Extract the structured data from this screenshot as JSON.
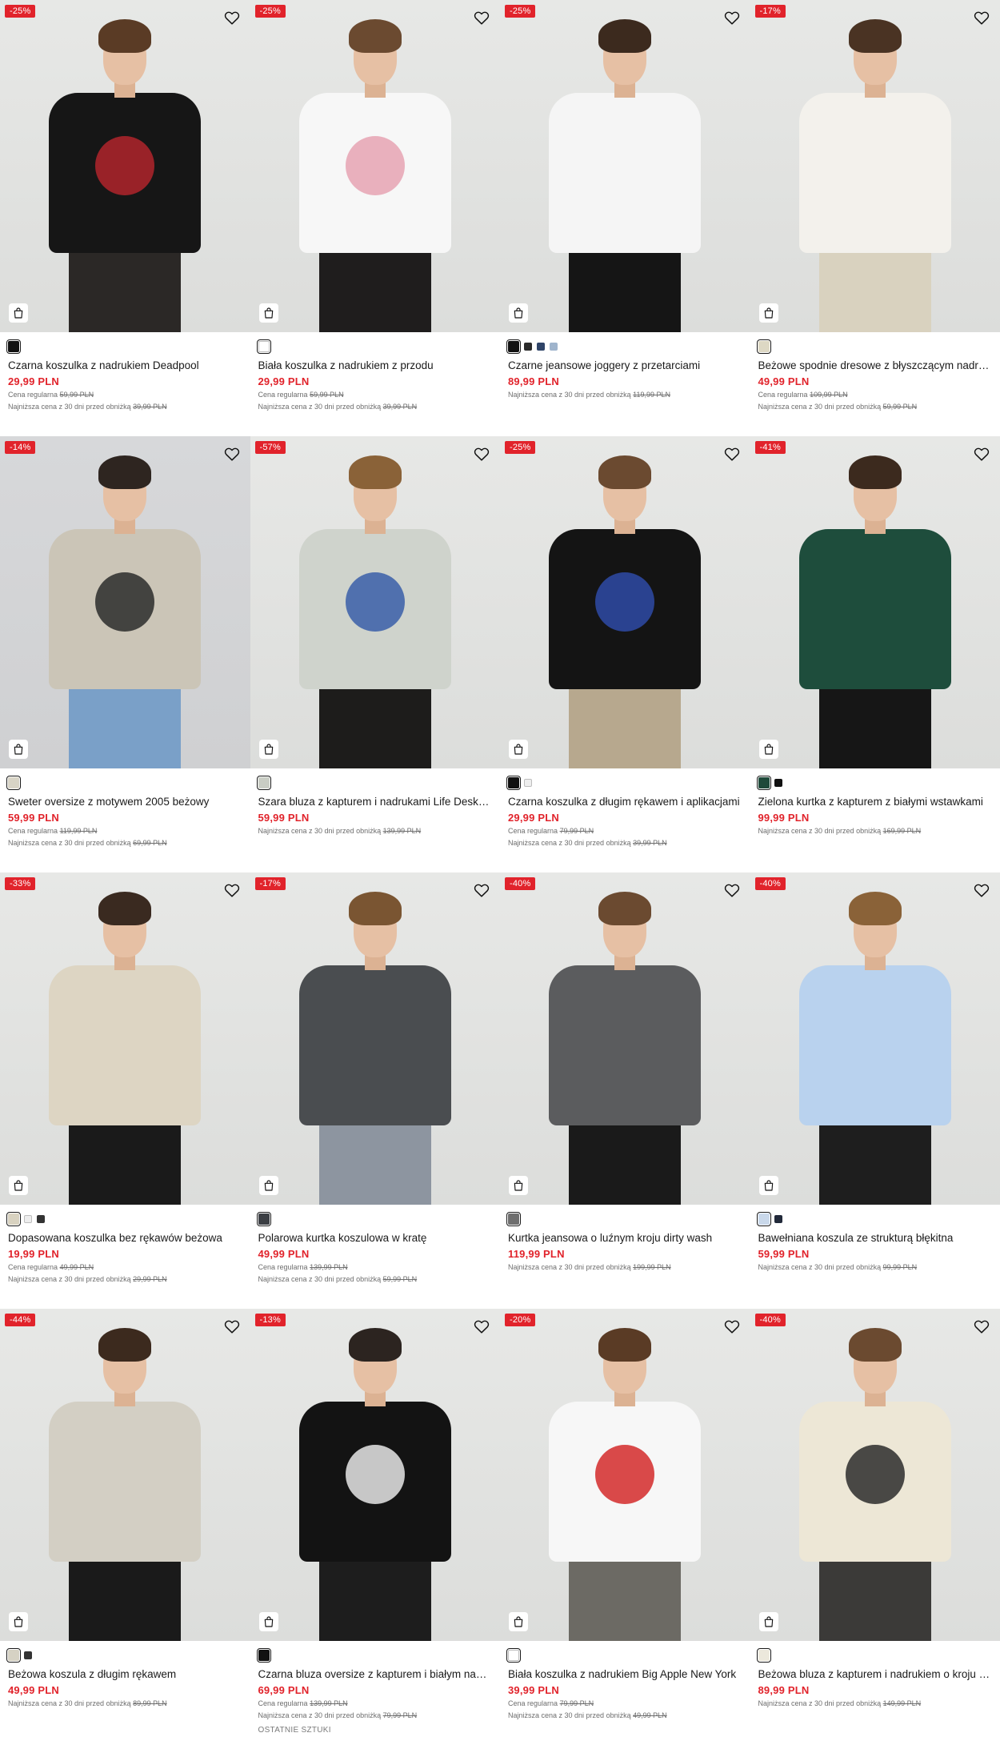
{
  "products": [
    {
      "badge": "-25%",
      "swatches": [
        "#111111"
      ],
      "name": "Czarna koszulka z nadrukiem Deadpool",
      "price": "29,99 PLN",
      "regular_label": "Cena regularna",
      "regular_price": "59,99 PLN",
      "lowest_label": "Najniższa cena z 30 dni przed obniżką",
      "lowest_price": "39,99 PLN",
      "extra": "",
      "look": {
        "top": "#161616",
        "legs": "#2b2826",
        "print": "#b0252c",
        "hair": "#5a3b25",
        "alt": false
      }
    },
    {
      "badge": "-25%",
      "swatches": [
        "#ffffff"
      ],
      "name": "Biała koszulka z nadrukiem z przodu",
      "price": "29,99 PLN",
      "regular_label": "Cena regularna",
      "regular_price": "59,99 PLN",
      "lowest_label": "Najniższa cena z 30 dni przed obniżką",
      "lowest_price": "39,99 PLN",
      "extra": "",
      "look": {
        "top": "#f7f7f7",
        "legs": "#1f1d1d",
        "print": "#e6a3b3",
        "hair": "#6b4a30",
        "alt": false
      }
    },
    {
      "badge": "-25%",
      "swatches": [
        "#111111",
        "#2a2a2a",
        "#2f4468",
        "#9fb4cc"
      ],
      "name": "Czarne jeansowe joggery z przetarciami",
      "price": "89,99 PLN",
      "regular_label": "",
      "regular_price": "",
      "lowest_label": "Najniższa cena z 30 dni przed obniżką",
      "lowest_price": "119,99 PLN",
      "extra": "",
      "look": {
        "top": "#f5f5f5",
        "legs": "#151515",
        "print": "",
        "hair": "#3c2a1e",
        "alt": false
      }
    },
    {
      "badge": "-17%",
      "swatches": [
        "#ddd8c4"
      ],
      "name": "Beżowe spodnie dresowe z błyszczącym nadrukiem",
      "price": "49,99 PLN",
      "regular_label": "Cena regularna",
      "regular_price": "109,99 PLN",
      "lowest_label": "Najniższa cena z 30 dni przed obniżką",
      "lowest_price": "59,99 PLN",
      "extra": "",
      "look": {
        "top": "#f3f1ec",
        "legs": "#d9d2bf",
        "print": "",
        "hair": "#4a3323",
        "alt": false
      }
    },
    {
      "badge": "-14%",
      "swatches": [
        "#d8d4c6"
      ],
      "name": "Sweter oversize z motywem 2005 beżowy",
      "price": "59,99 PLN",
      "regular_label": "Cena regularna",
      "regular_price": "119,99 PLN",
      "lowest_label": "Najniższa cena z 30 dni przed obniżką",
      "lowest_price": "69,99 PLN",
      "extra": "",
      "look": {
        "top": "#cbc5b7",
        "legs": "#7aa0c8",
        "print": "#2b2b2b",
        "hair": "#2e2520",
        "alt": true
      }
    },
    {
      "badge": "-57%",
      "swatches": [
        "#c9cdc4"
      ],
      "name": "Szara bluza z kapturem i nadrukami Life Desktop",
      "price": "59,99 PLN",
      "regular_label": "",
      "regular_price": "",
      "lowest_label": "Najniższa cena z 30 dni przed obniżką",
      "lowest_price": "139,99 PLN",
      "extra": "",
      "look": {
        "top": "#cfd3cc",
        "legs": "#1d1c1b",
        "print": "#3a5ea8",
        "hair": "#8a6238",
        "alt": false
      }
    },
    {
      "badge": "-25%",
      "swatches": [
        "#111111",
        "#eeeeee"
      ],
      "name": "Czarna koszulka z długim rękawem i aplikacjami",
      "price": "29,99 PLN",
      "regular_label": "Cena regularna",
      "regular_price": "79,99 PLN",
      "lowest_label": "Najniższa cena z 30 dni przed obniżką",
      "lowest_price": "39,99 PLN",
      "extra": "",
      "look": {
        "top": "#141414",
        "legs": "#b7a88e",
        "print": "#2e4aa6",
        "hair": "#6b4a30",
        "alt": false
      }
    },
    {
      "badge": "-41%",
      "swatches": [
        "#1f4a3a",
        "#111111"
      ],
      "name": "Zielona kurtka z kapturem z białymi wstawkami",
      "price": "99,99 PLN",
      "regular_label": "",
      "regular_price": "",
      "lowest_label": "Najniższa cena z 30 dni przed obniżką",
      "lowest_price": "169,99 PLN",
      "extra": "",
      "look": {
        "top": "#1e4d3c",
        "legs": "#161616",
        "print": "",
        "hair": "#3c2a1e",
        "alt": false
      }
    },
    {
      "badge": "-33%",
      "swatches": [
        "#d8d2c0",
        "#eeeeee",
        "#333333"
      ],
      "name": "Dopasowana koszulka bez rękawów beżowa",
      "price": "19,99 PLN",
      "regular_label": "Cena regularna",
      "regular_price": "49,99 PLN",
      "lowest_label": "Najniższa cena z 30 dni przed obniżką",
      "lowest_price": "29,99 PLN",
      "extra": "",
      "look": {
        "top": "#ddd5c3",
        "legs": "#1a1a1a",
        "print": "",
        "hair": "#3a2a20",
        "alt": false
      }
    },
    {
      "badge": "-17%",
      "swatches": [
        "#3c3f44"
      ],
      "name": "Polarowa kurtka koszulowa w kratę",
      "price": "49,99 PLN",
      "regular_label": "Cena regularna",
      "regular_price": "139,99 PLN",
      "lowest_label": "Najniższa cena z 30 dni przed obniżką",
      "lowest_price": "59,99 PLN",
      "extra": "",
      "look": {
        "top": "#4a4d50",
        "legs": "#8d95a0",
        "print": "",
        "hair": "#7a5532",
        "alt": false
      }
    },
    {
      "badge": "-40%",
      "swatches": [
        "#6f6f6f"
      ],
      "name": "Kurtka jeansowa o luźnym kroju dirty wash",
      "price": "119,99 PLN",
      "regular_label": "",
      "regular_price": "",
      "lowest_label": "Najniższa cena z 30 dni przed obniżką",
      "lowest_price": "199,99 PLN",
      "extra": "",
      "look": {
        "top": "#5b5c5e",
        "legs": "#1a1a1a",
        "print": "",
        "hair": "#6b4a30",
        "alt": false
      }
    },
    {
      "badge": "-40%",
      "swatches": [
        "#c9d8ea",
        "#222a3a"
      ],
      "name": "Bawełniana koszula ze strukturą błękitna",
      "price": "59,99 PLN",
      "regular_label": "",
      "regular_price": "",
      "lowest_label": "Najniższa cena z 30 dni przed obniżką",
      "lowest_price": "99,99 PLN",
      "extra": "",
      "look": {
        "top": "#b9d2ee",
        "legs": "#1e1e1e",
        "print": "",
        "hair": "#8a6238",
        "alt": false
      }
    },
    {
      "badge": "-44%",
      "swatches": [
        "#d6d2c4",
        "#333333"
      ],
      "name": "Beżowa koszula z długim rękawem",
      "price": "49,99 PLN",
      "regular_label": "",
      "regular_price": "",
      "lowest_label": "Najniższa cena z 30 dni przed obniżką",
      "lowest_price": "89,99 PLN",
      "extra": "",
      "look": {
        "top": "#d3cfc4",
        "legs": "#1a1a1a",
        "print": "",
        "hair": "#3c2a1e",
        "alt": false
      }
    },
    {
      "badge": "-13%",
      "swatches": [
        "#111111"
      ],
      "name": "Czarna bluza oversize z kapturem i białym nadrukiem",
      "price": "69,99 PLN",
      "regular_label": "Cena regularna",
      "regular_price": "139,99 PLN",
      "lowest_label": "Najniższa cena z 30 dni przed obniżką",
      "lowest_price": "79,99 PLN",
      "extra": "OSTATNIE SZTUKI",
      "look": {
        "top": "#131313",
        "legs": "#1d1d1d",
        "print": "#e8e8e8",
        "hair": "#2c2420",
        "alt": false
      }
    },
    {
      "badge": "-20%",
      "swatches": [
        "#ffffff"
      ],
      "name": "Biała koszulka z nadrukiem Big Apple New York",
      "price": "39,99 PLN",
      "regular_label": "Cena regularna",
      "regular_price": "79,99 PLN",
      "lowest_label": "Najniższa cena z 30 dni przed obniżką",
      "lowest_price": "49,99 PLN",
      "extra": "",
      "look": {
        "top": "#f7f7f7",
        "legs": "#6c6a64",
        "print": "#d42a2a",
        "hair": "#5a3b25",
        "alt": false
      }
    },
    {
      "badge": "-40%",
      "swatches": [
        "#ece8dc"
      ],
      "name": "Beżowa bluza z kapturem i nadrukiem o kroju oversize",
      "price": "89,99 PLN",
      "regular_label": "",
      "regular_price": "",
      "lowest_label": "Najniższa cena z 30 dni przed obniżką",
      "lowest_price": "149,99 PLN",
      "extra": "",
      "look": {
        "top": "#ede7d6",
        "legs": "#3b3a38",
        "print": "#2b2b2b",
        "hair": "#6b4a30",
        "alt": false
      }
    }
  ],
  "colors": {
    "accent": "#e1232b",
    "text": "#1a1a1a",
    "muted": "#6d6d6d"
  },
  "icons": {
    "wishlist": "heart-icon",
    "cart": "shopping-bag-icon"
  }
}
